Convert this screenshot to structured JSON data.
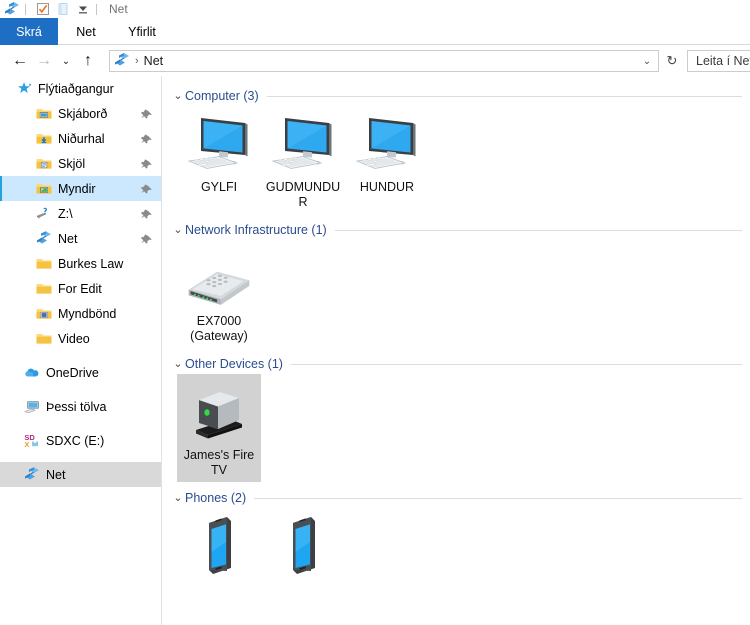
{
  "window": {
    "title": "Net",
    "quick_access": [
      {
        "name": "network-icon",
        "label": "Net"
      },
      {
        "name": "properties-icon",
        "label": "Eiginleikar"
      },
      {
        "name": "new-folder-icon",
        "label": "Ný mappa"
      },
      {
        "name": "customize-dropdown-icon",
        "label": "Sérsníða flýtitækjastiku"
      }
    ]
  },
  "ribbon": {
    "tabs": [
      {
        "label": "Skrá",
        "active": true
      },
      {
        "label": "Net",
        "active": false
      },
      {
        "label": "Yfirlit",
        "active": false
      }
    ]
  },
  "navbar": {
    "back": "←",
    "forward": "→",
    "recent": "⌄",
    "up": "↑",
    "refresh": "↻",
    "dropdown": "⌄",
    "address": {
      "icon": "network-globe-icon",
      "separator": "›",
      "crumb": "Net"
    },
    "search_placeholder": "Leita í Net"
  },
  "sidebar": {
    "items": [
      {
        "label": "Flýtiaðgangur",
        "icon": "star-icon",
        "indent": 0,
        "pin": false,
        "selected": false
      },
      {
        "label": "Skjáborð",
        "icon": "folder-desktop-icon",
        "indent": 1,
        "pin": true,
        "selected": false
      },
      {
        "label": "Niðurhal",
        "icon": "folder-downloads-icon",
        "indent": 1,
        "pin": true,
        "selected": false
      },
      {
        "label": "Skjöl",
        "icon": "folder-documents-icon",
        "indent": 1,
        "pin": true,
        "selected": false
      },
      {
        "label": "Myndir",
        "icon": "folder-pictures-icon",
        "indent": 1,
        "pin": true,
        "selected": true
      },
      {
        "label": "Z:\\",
        "icon": "disconnected-drive-icon",
        "indent": 1,
        "pin": true,
        "selected": false
      },
      {
        "label": "Net",
        "icon": "network-globe-icon",
        "indent": 1,
        "pin": true,
        "selected": false
      },
      {
        "label": "Burkes Law",
        "icon": "folder-icon",
        "indent": 1,
        "pin": false,
        "selected": false
      },
      {
        "label": "For Edit",
        "icon": "folder-icon",
        "indent": 1,
        "pin": false,
        "selected": false
      },
      {
        "label": "Myndbönd",
        "icon": "folder-videos-icon",
        "indent": 1,
        "pin": false,
        "selected": false
      },
      {
        "label": "Video",
        "icon": "folder-icon",
        "indent": 1,
        "pin": false,
        "selected": false
      },
      {
        "label": "OneDrive",
        "icon": "onedrive-cloud-icon",
        "indent": 0,
        "pin": false,
        "selected": false
      },
      {
        "label": "Þessi tölva",
        "icon": "this-pc-icon",
        "indent": 0,
        "pin": false,
        "selected": false
      },
      {
        "label": "SDXC (E:)",
        "icon": "sd-card-icon",
        "indent": 0,
        "pin": false,
        "selected": false
      },
      {
        "label": "Net",
        "icon": "network-globe-icon",
        "indent": 0,
        "pin": false,
        "selected": "gray"
      }
    ]
  },
  "content": {
    "groups": [
      {
        "title": "Computer (3)",
        "chevron": "⌄",
        "items": [
          {
            "label": "GYLFI",
            "icon": "desktop-computer-icon",
            "selected": false
          },
          {
            "label": "GUDMUNDUR",
            "icon": "desktop-computer-icon",
            "selected": false
          },
          {
            "label": "HUNDUR",
            "icon": "desktop-computer-icon",
            "selected": false
          }
        ]
      },
      {
        "title": "Network Infrastructure (1)",
        "chevron": "⌄",
        "items": [
          {
            "label": "EX7000\n(Gateway)",
            "icon": "router-icon",
            "selected": false
          }
        ]
      },
      {
        "title": "Other Devices (1)",
        "chevron": "⌄",
        "items": [
          {
            "label": "James's Fire TV",
            "icon": "media-device-icon",
            "selected": true
          }
        ]
      },
      {
        "title": "Phones (2)",
        "chevron": "⌄",
        "items": [
          {
            "label": "",
            "icon": "phone-icon",
            "selected": false
          },
          {
            "label": "",
            "icon": "phone-icon",
            "selected": false
          }
        ]
      }
    ]
  },
  "colors": {
    "file_tab": "#1e6fc4",
    "group_header_text": "#2a4d8f",
    "selection_blue": "#cce8ff",
    "selection_gray": "#d2d2d2",
    "accent_bar": "#26a0da"
  }
}
